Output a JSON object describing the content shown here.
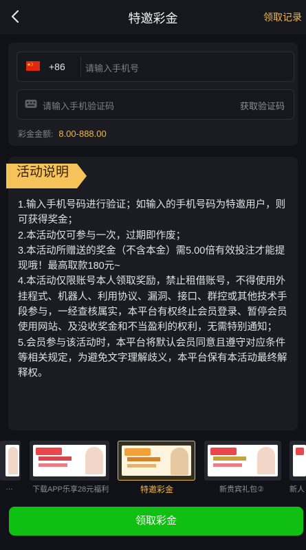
{
  "header": {
    "title": "特邀彩金",
    "record_link": "领取记录"
  },
  "form": {
    "country_code": "+86",
    "phone_placeholder": "请输入手机号",
    "code_placeholder": "请输入手机验证码",
    "get_code_label": "获取验证码",
    "amount_label": "彩金金额:",
    "amount_value": "8.00-888.00"
  },
  "description": {
    "heading": "活动说明",
    "rules": [
      "1.输入手机号码进行验证；如输入的手机号码为特邀用户，则可获得奖金；",
      "2.本活动仅可参与一次，过期即作废；",
      "3.本活动所赠送的奖金（不含本金）需5.00倍有效投注才能提现哦！最高取款180元~",
      "4.本活动仅限账号本人领取奖励，禁止租借账号，不得使用外挂程式、机器人、利用协议、漏洞、接口、群控或其他技术手段参与，一经查核属实，本平台有权终止会员登录、暂停会员使用网站、及没收奖金和不当盈利的权利，无需特别通知；",
      "5.会员参与该活动时，本平台将默认会员同意且遵守对应条件等相关规定，为避免文字理解歧义，本平台保有本活动最终解释权。"
    ]
  },
  "promos": [
    {
      "label": "…"
    },
    {
      "label": "下载APP乐享28元福利"
    },
    {
      "label": "特邀彩金",
      "active": true
    },
    {
      "label": "新贵宾礼包②"
    },
    {
      "label": "新人"
    }
  ],
  "cta": {
    "label": "领取彩金"
  },
  "colors": {
    "accent": "#f0b94c",
    "cta": "#0fbf11",
    "background": "#111217"
  }
}
